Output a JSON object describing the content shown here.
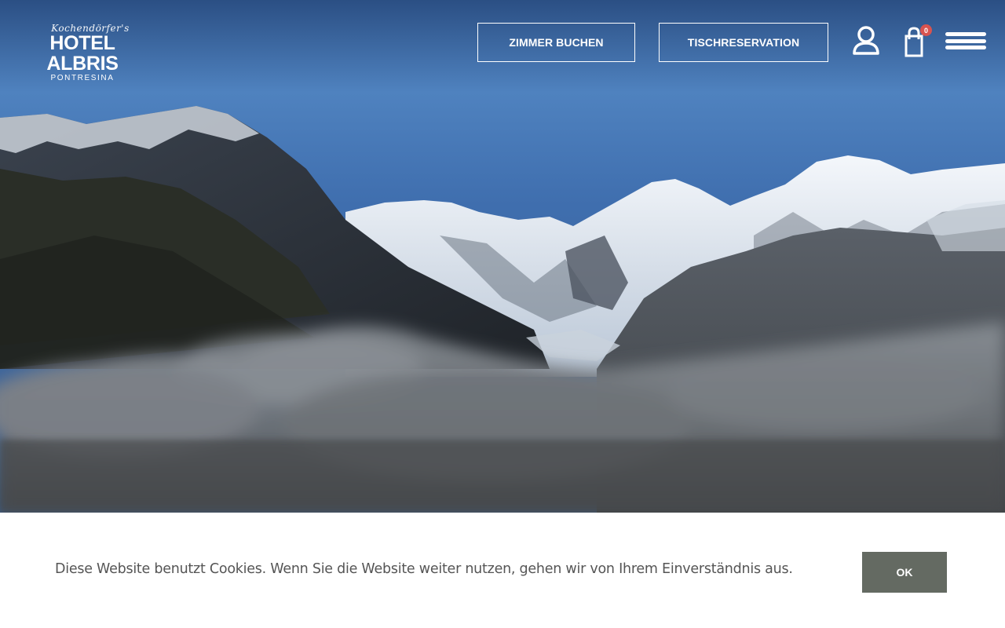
{
  "hotel": {
    "prefix": "Kochendörfer's",
    "name": "HOTEL ALBRIS",
    "location": "PONTRESINA"
  },
  "header": {
    "book_room_label": "ZIMMER BUCHEN",
    "table_reservation_label": "TISCHRESERVATION",
    "cart_count": "0",
    "icons": [
      "user-icon",
      "shopping-bag-icon",
      "hamburger-menu-icon"
    ]
  },
  "hero": {
    "image": "mountain-panorama-with-glacier-and-clouds"
  },
  "cookie_banner": {
    "text": "Diese Website benutzt Cookies. Wenn Sie die Website weiter nutzen, gehen wir von Ihrem Einverständnis aus.",
    "ok_label": "OK"
  },
  "colors": {
    "badge": "#d9534f",
    "ok_button": "#646a62",
    "cookie_text": "#555555"
  }
}
